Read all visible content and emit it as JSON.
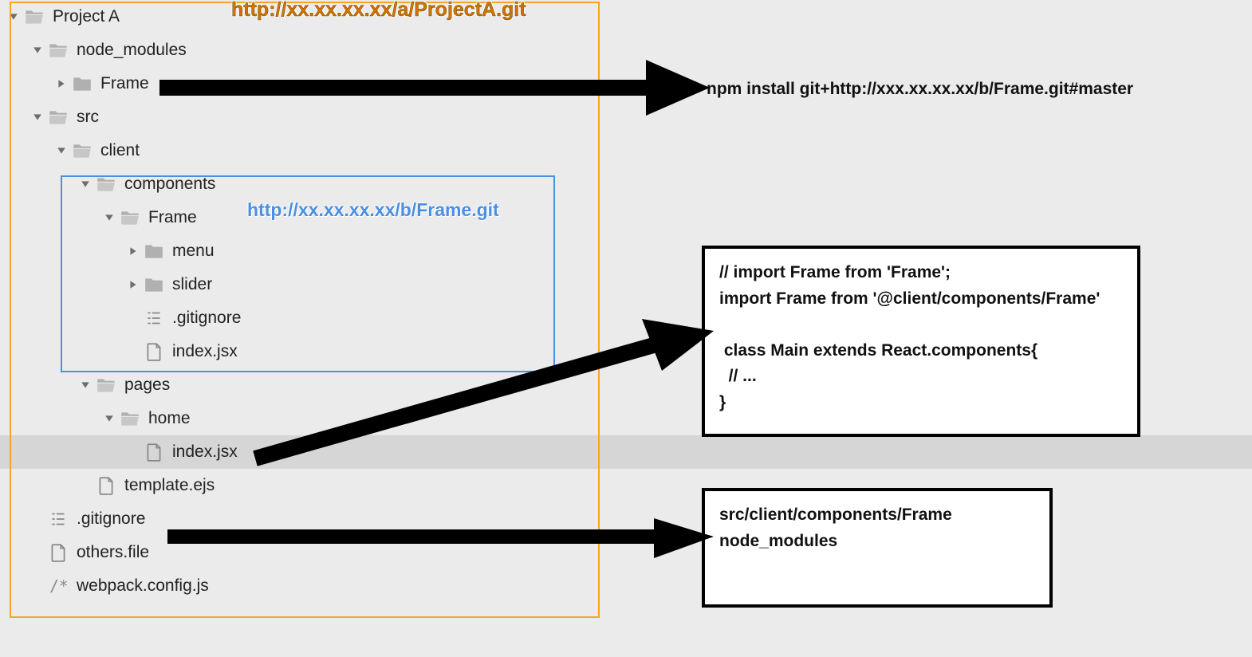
{
  "annotations": {
    "orange_url": "http://xx.xx.xx.xx/a/ProjectA.git",
    "blue_url": "http://xx.xx.xx.xx/b/Frame.git",
    "npm_command": "npm install git+http://xxx.xx.xx.xx/b/Frame.git#master"
  },
  "code_box_main": "// import Frame from 'Frame';\nimport Frame from '@client/components/Frame'\n\n class Main extends React.components{\n  // ...\n}",
  "code_box_gitignore": "src/client/components/Frame\nnode_modules",
  "tree": {
    "project": "Project A",
    "node_modules": "node_modules",
    "node_modules_frame": "Frame",
    "src": "src",
    "client": "client",
    "components": "components",
    "components_frame": "Frame",
    "menu": "menu",
    "slider": "slider",
    "gitignore_inner": ".gitignore",
    "index_jsx_frame": "index.jsx",
    "pages": "pages",
    "home": "home",
    "index_jsx_home": "index.jsx",
    "template_ejs": "template.ejs",
    "gitignore_root": ".gitignore",
    "others_file": "others.file",
    "webpack_config": "webpack.config.js"
  }
}
